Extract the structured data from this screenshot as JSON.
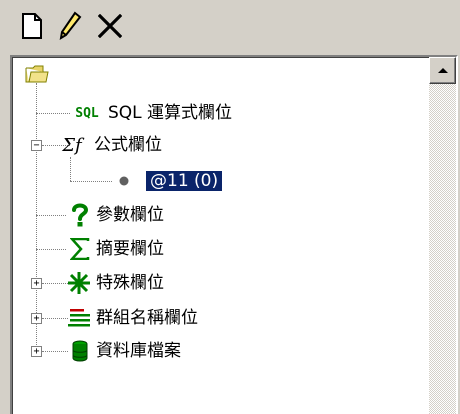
{
  "toolbar": {
    "new_icon": "new-document-icon",
    "edit_icon": "pencil-icon",
    "delete_icon": "delete-x-icon"
  },
  "tree": {
    "items": [
      {
        "label": "SQL 運算式欄位",
        "icon_text": "SQL",
        "icon": "sql-icon"
      },
      {
        "label": "公式欄位",
        "icon_text": "Σf",
        "icon": "formula-icon",
        "expander": "−"
      },
      {
        "label": "@11 (0)",
        "icon": "bullet-icon"
      },
      {
        "label": "參數欄位",
        "icon": "question-icon"
      },
      {
        "label": "摘要欄位",
        "icon": "sigma-icon"
      },
      {
        "label": "特殊欄位",
        "icon": "special-icon",
        "expander": "+"
      },
      {
        "label": "群組名稱欄位",
        "icon": "group-name-icon",
        "expander": "+"
      },
      {
        "label": "資料庫檔案",
        "icon": "database-icon",
        "expander": "+"
      }
    ]
  },
  "colors": {
    "selection": "#0a246a",
    "icon_green": "#008000",
    "window": "#d4d0c8"
  }
}
